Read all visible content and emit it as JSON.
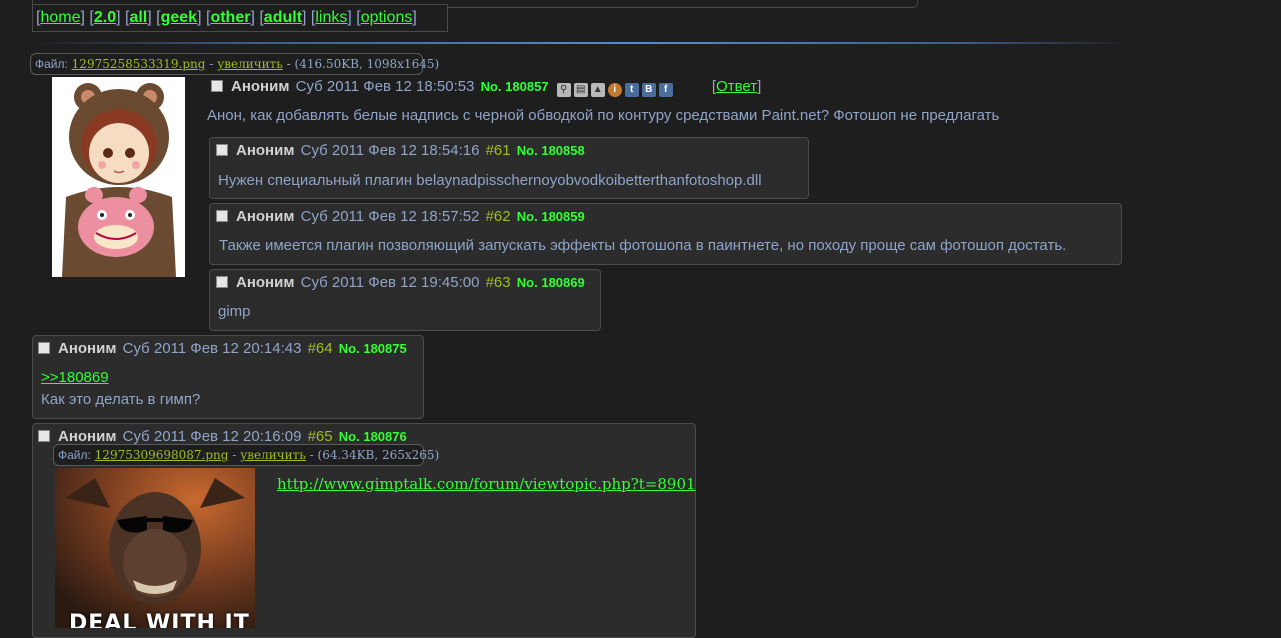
{
  "nav": {
    "open": "[",
    "close": "]",
    "items": [
      "home",
      "2.0",
      "all",
      "geek",
      "other",
      "adult",
      "links",
      "options"
    ]
  },
  "op": {
    "file": {
      "label": "Файл:",
      "name": "12975258533319.png",
      "sep1": "-",
      "enlarge": "увеличить",
      "info": "- (416.50KB, 1098x1645)"
    },
    "name": "Аноним",
    "date": "Суб 2011 Фев 12 18:50:53",
    "no": "No. 180857",
    "reply": "Ответ",
    "text": "Анон, как добавлять белые надпись с черной обводкой по контуру средствами Paint.net? Фотошоп не предлагать"
  },
  "replies": [
    {
      "name": "Аноним",
      "date": "Суб 2011 Фев 12 18:54:16",
      "num": "#61",
      "no": "No. 180858",
      "text": "Нужен специальный плагин belaynadpisschernoyobvodkoibetterthanfotoshop.dll"
    },
    {
      "name": "Аноним",
      "date": "Суб 2011 Фев 12 18:57:52",
      "num": "#62",
      "no": "No. 180859",
      "text": "Также имеется плагин позволяющий запускать эффекты фотошопа в паинтнете, но походу проще сам фотошоп достать."
    },
    {
      "name": "Аноним",
      "date": "Суб 2011 Фев 12 19:45:00",
      "num": "#63",
      "no": "No. 180869",
      "text": "gimp"
    },
    {
      "name": "Аноним",
      "date": "Суб 2011 Фев 12 20:14:43",
      "num": "#64",
      "no": "No. 180875",
      "quote": ">>180869",
      "text": "Как это делать в гимп?"
    },
    {
      "name": "Аноним",
      "date": "Суб 2011 Фев 12 20:16:09",
      "num": "#65",
      "no": "No. 180876",
      "file": {
        "label": "Файл:",
        "name": "12975309698087.png",
        "sep1": "-",
        "enlarge": "увеличить",
        "info": "- (64.34KB, 265x265)"
      },
      "link": "http://www.gimptalk.com/forum/viewtopic.php?t=8901",
      "image_caption": "DEAL WITH IT"
    }
  ],
  "colors": {
    "background": "#1e1e1e",
    "post_bg": "#2c2c2c",
    "link": "#33ff33",
    "text": "#8fa4c8",
    "name": "#d2d2d2",
    "post_number": "#9fbe1f"
  }
}
